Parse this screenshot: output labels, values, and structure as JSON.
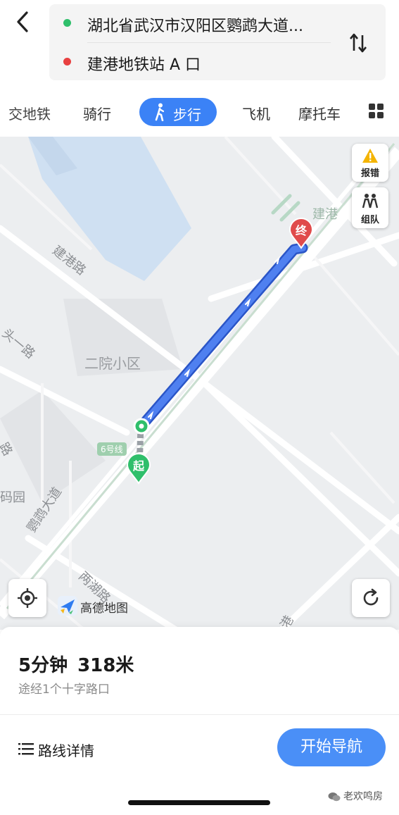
{
  "header": {
    "start_location": "湖北省武汉市汉阳区鹦鹉大道...",
    "end_location": "建港地铁站 A 口"
  },
  "tabs": {
    "items": [
      "交地铁",
      "骑行",
      "步行",
      "飞机",
      "摩托车"
    ],
    "active": "步行"
  },
  "map": {
    "labels": {
      "road_jiangang": "建港路",
      "road_toutou": "头一路",
      "community": "二院小区",
      "road_yingwu": "鹦鹉大道",
      "road_lianghu": "两湖路",
      "station_partial": "建港",
      "left_partial_1": "路",
      "left_partial_2": "码园",
      "bottom_partial": "港",
      "metro_line": "6号线"
    },
    "markers": {
      "start": "起",
      "end": "终"
    },
    "buttons": {
      "report": "报错",
      "team": "组队"
    },
    "logo_text": "高德地图"
  },
  "summary": {
    "duration": "5分钟",
    "distance": "318米",
    "via": "途经1个十字路口"
  },
  "actions": {
    "details": "路线详情",
    "start_nav": "开始导航"
  },
  "watermark": "老欢鸣房",
  "colors": {
    "accent": "#3b82f6",
    "route": "#3f6fe0",
    "start_green": "#2fbf6b",
    "end_red": "#e84040",
    "water": "#cfe0f2"
  }
}
